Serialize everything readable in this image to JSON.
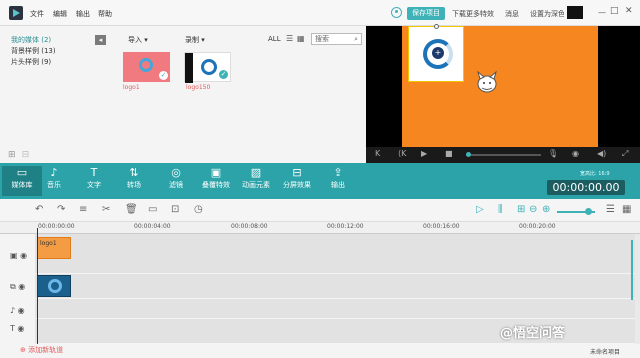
{
  "menu": {
    "file": "文件",
    "edit": "编辑",
    "export": "输出",
    "help": "帮助"
  },
  "titlebar": {
    "save_label": "保存项目",
    "download_more": "下载更多特效",
    "messages": "消息",
    "settings": "设置为深色模式"
  },
  "sidebar": {
    "items": [
      {
        "label": "我的媒体 (2)"
      },
      {
        "label": "背景样例 (13)"
      },
      {
        "label": "片头样例 (9)"
      }
    ]
  },
  "media_toolbar": {
    "import": "导入",
    "record": "录制",
    "all": "ALL",
    "search_placeholder": "搜索"
  },
  "media_items": [
    {
      "label": "logo1"
    },
    {
      "label": "logo150"
    }
  ],
  "toolbar": {
    "tools": [
      {
        "label": "媒体库",
        "icon": "folder-icon"
      },
      {
        "label": "音乐",
        "icon": "music-note-icon"
      },
      {
        "label": "文字",
        "icon": "text-icon"
      },
      {
        "label": "转场",
        "icon": "transition-icon"
      },
      {
        "label": "滤镜",
        "icon": "filter-icon"
      },
      {
        "label": "叠覆特效",
        "icon": "overlay-icon"
      },
      {
        "label": "动画元素",
        "icon": "elements-icon"
      },
      {
        "label": "分屏效果",
        "icon": "split-screen-icon"
      },
      {
        "label": "输出",
        "icon": "export-icon"
      }
    ],
    "aspect_ratio": "宽高比: 16:9",
    "timecode": "00:00:00.00"
  },
  "ruler": {
    "ticks": [
      "00:00:00:00",
      "00:00:04:00",
      "00:00:08:00",
      "00:00:12:00",
      "00:00:16:00",
      "00:00:20:00"
    ]
  },
  "tracks": {
    "clip_overlay_label": "logo1",
    "add_track": "添加新轨道"
  },
  "footer": {
    "project_name": "未命名项目"
  },
  "watermark": "@悟空问答",
  "colors": {
    "accent": "#3fb2b7",
    "toolbar": "#2ba3a8",
    "preview_bg": "#f6861f"
  }
}
